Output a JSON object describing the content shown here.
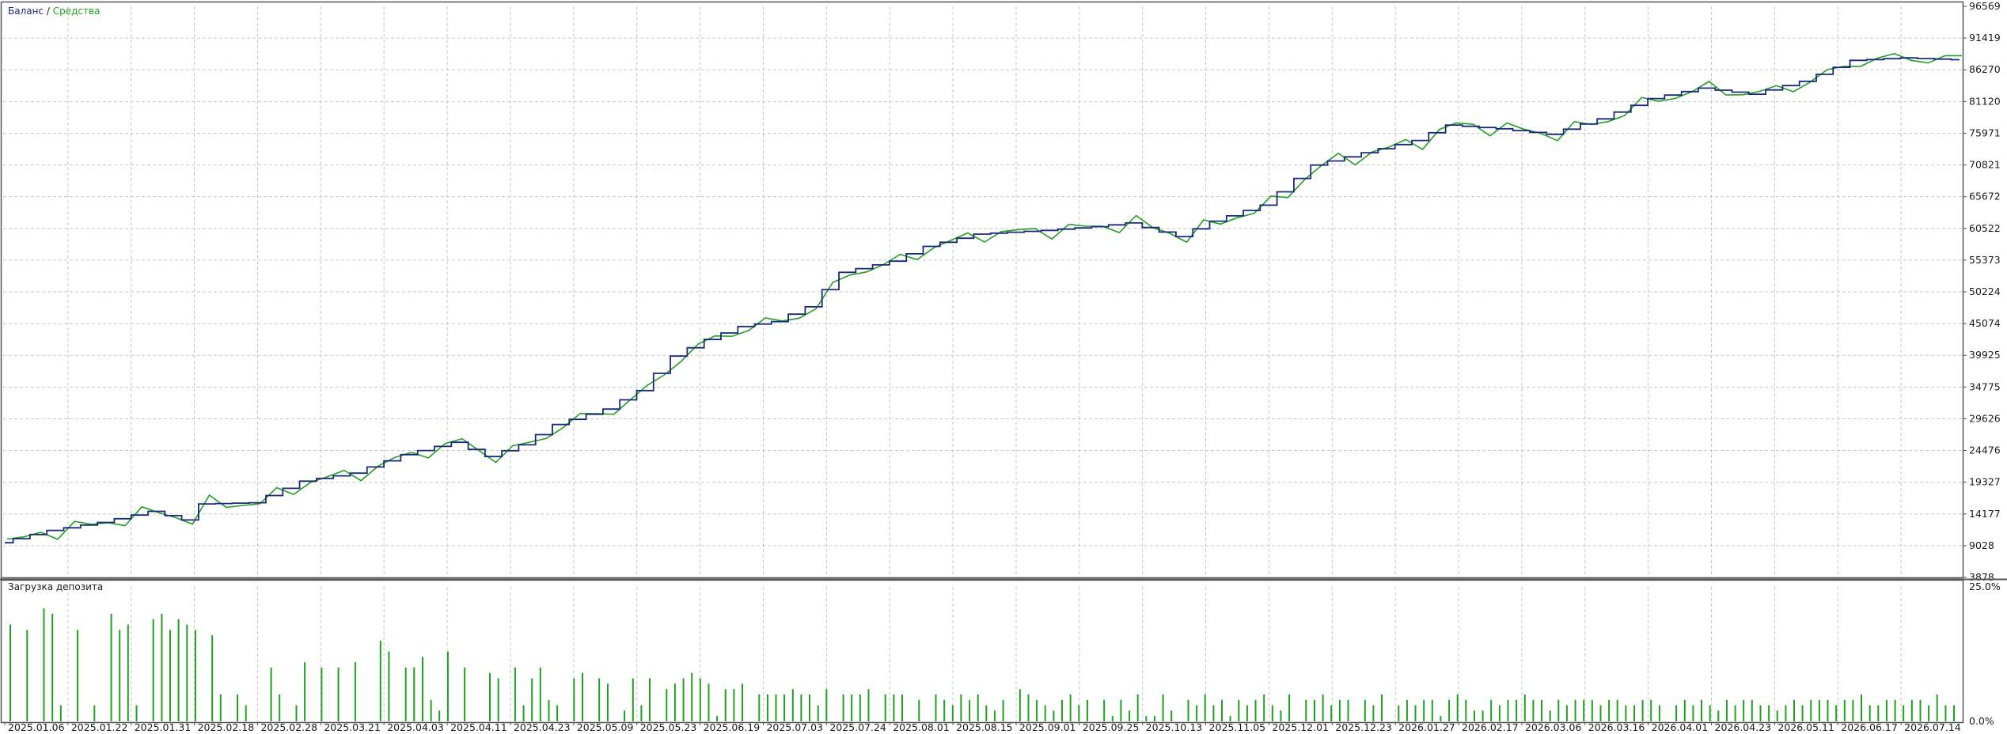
{
  "chart_data": [
    {
      "type": "line",
      "title_balance": "Баланс",
      "title_separator": " / ",
      "title_equity": "Средства",
      "ylim": [
        3878,
        96569
      ],
      "y_ticks": [
        "96569",
        "91419",
        "86270",
        "81120",
        "75971",
        "70821",
        "65672",
        "60522",
        "55373",
        "50224",
        "45074",
        "39925",
        "34775",
        "29626",
        "24476",
        "19327",
        "14177",
        "9028",
        "3878"
      ],
      "x_ticks": [
        "2025.01.06",
        "2025.01.22",
        "2025.01.31",
        "2025.02.18",
        "2025.02.28",
        "2025.03.21",
        "2025.04.03",
        "2025.04.11",
        "2025.04.23",
        "2025.05.09",
        "2025.05.23",
        "2025.06.19",
        "2025.07.03",
        "2025.07.24",
        "2025.08.01",
        "2025.08.15",
        "2025.09.01",
        "2025.09.25",
        "2025.10.13",
        "2025.11.05",
        "2025.12.01",
        "2025.12.23",
        "2026.01.27",
        "2026.02.17",
        "2026.03.06",
        "2026.03.16",
        "2026.04.01",
        "2026.04.23",
        "2026.05.11",
        "2026.06.17",
        "2026.07.14"
      ],
      "grid": true,
      "colors": {
        "balance": "#1a2a7a",
        "equity": "#22a022",
        "grid": "#c8c8c8",
        "axis": "#555555"
      },
      "balance_anchors": [
        [
          0,
          9500
        ],
        [
          3,
          11500
        ],
        [
          6,
          12800
        ],
        [
          9,
          14600
        ],
        [
          11,
          13200
        ],
        [
          12,
          15800
        ],
        [
          15,
          16000
        ],
        [
          18,
          19500
        ],
        [
          21,
          20800
        ],
        [
          24,
          23800
        ],
        [
          27,
          25800
        ],
        [
          29,
          23500
        ],
        [
          31,
          25400
        ],
        [
          33,
          28700
        ],
        [
          36,
          31200
        ],
        [
          38,
          34200
        ],
        [
          40,
          39800
        ],
        [
          42,
          42500
        ],
        [
          44,
          44600
        ],
        [
          46,
          45400
        ],
        [
          48,
          47800
        ],
        [
          50,
          53400
        ],
        [
          53,
          55200
        ],
        [
          55,
          57600
        ],
        [
          58,
          59600
        ],
        [
          62,
          60200
        ],
        [
          65,
          60800
        ],
        [
          67,
          61400
        ],
        [
          70,
          59200
        ],
        [
          72,
          61700
        ],
        [
          75,
          64300
        ],
        [
          78,
          70800
        ],
        [
          81,
          72800
        ],
        [
          84,
          74800
        ],
        [
          86,
          77300
        ],
        [
          89,
          76700
        ],
        [
          92,
          75800
        ],
        [
          95,
          78300
        ],
        [
          98,
          81600
        ],
        [
          101,
          83300
        ],
        [
          104,
          82300
        ],
        [
          107,
          84400
        ],
        [
          110,
          87800
        ],
        [
          113,
          88200
        ],
        [
          116,
          87900
        ]
      ],
      "n_points": 117
    },
    {
      "type": "bar",
      "title": "Загрузка депозита",
      "ylim": [
        0,
        25
      ],
      "y_ticks": [
        "25.0%",
        "0.0%"
      ],
      "colors": {
        "bar": "#22a022"
      },
      "values": [
        18,
        0,
        17,
        0,
        21,
        20,
        3,
        0,
        17,
        0,
        3,
        0,
        20,
        17,
        18,
        3,
        0,
        19,
        20,
        17,
        19,
        18,
        17,
        0,
        16,
        5,
        0,
        5,
        3,
        0,
        0,
        10,
        5,
        0,
        3,
        11,
        0,
        10,
        0,
        10,
        0,
        11,
        0,
        0,
        15,
        13,
        0,
        10,
        10,
        12,
        4,
        2,
        13,
        0,
        10,
        0,
        0,
        9,
        8,
        0,
        10,
        3,
        8,
        10,
        4,
        3,
        0,
        8,
        9,
        0,
        8,
        7,
        0,
        2,
        8,
        3,
        8,
        0,
        6,
        7,
        8,
        9,
        8,
        7,
        1,
        6,
        6,
        7,
        0,
        5,
        5,
        5,
        5,
        6,
        5,
        5,
        3,
        6,
        0,
        5,
        5,
        5,
        6,
        0,
        5,
        5,
        5,
        0,
        4,
        0,
        5,
        4,
        3,
        5,
        4,
        5,
        3,
        2,
        4,
        0,
        6,
        5,
        4,
        3,
        2,
        4,
        5,
        3,
        4,
        0,
        4,
        1,
        4,
        2,
        5,
        1,
        1,
        5,
        2,
        0,
        4,
        3,
        5,
        3,
        4,
        1,
        4,
        3,
        4,
        5,
        3,
        2,
        5,
        0,
        4,
        4,
        5,
        3,
        4,
        4,
        0,
        4,
        3,
        5,
        0,
        3,
        4,
        3,
        4,
        4,
        1,
        4,
        5,
        4,
        2,
        2,
        4,
        3,
        4,
        4,
        5,
        4,
        4,
        2,
        4,
        3,
        4,
        4,
        4,
        3,
        4,
        4,
        3,
        3,
        4,
        4,
        3,
        0,
        3,
        4,
        3,
        4,
        3,
        2,
        4,
        3,
        4,
        4,
        3,
        3,
        2,
        3,
        4,
        3,
        4,
        4,
        4,
        3,
        4,
        4,
        5,
        3,
        3,
        4,
        4,
        3,
        4,
        4,
        3,
        5,
        3,
        3
      ]
    }
  ]
}
